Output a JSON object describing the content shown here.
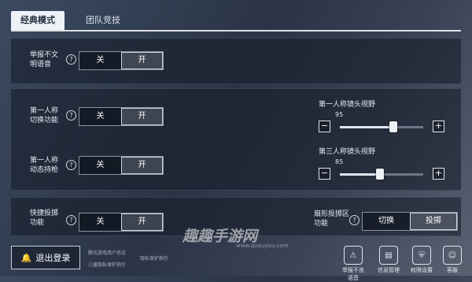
{
  "tabs": [
    {
      "label": "经典模式",
      "active": true
    },
    {
      "label": "团队竞技",
      "active": false
    }
  ],
  "rows": {
    "voice": {
      "label": "举报不文明语音",
      "off": "关",
      "on": "开",
      "selected": "开"
    },
    "fpp_switch": {
      "label": "第一人称切换功能",
      "off": "关",
      "on": "开",
      "selected": "开"
    },
    "fpp_hold": {
      "label": "第一人称动态持枪",
      "off": "关",
      "on": "开",
      "selected": "开"
    },
    "quick_throw": {
      "label": "快捷投掷功能",
      "off": "关",
      "on": "开",
      "selected": "开"
    },
    "fan_throw": {
      "label": "扇形投掷区功能",
      "a": "切换",
      "b": "投掷",
      "selected": "投掷"
    }
  },
  "sliders": {
    "fpp_fov": {
      "label": "第一人称镜头视野",
      "value": "95",
      "fraction": 0.64,
      "minus": "−",
      "plus": "+"
    },
    "tpp_fov": {
      "label": "第三人称镜头视野",
      "value": "85",
      "fraction": 0.48,
      "minus": "−",
      "plus": "+"
    }
  },
  "help_glyph": "?",
  "footer": {
    "logout": "退出登录",
    "links": [
      "腾讯游戏用户协议",
      "儿童隐私保护指引",
      "隐私保护指引"
    ],
    "icons": [
      {
        "name": "report-voice-icon",
        "glyph": "⚠",
        "label": "举报不良语音"
      },
      {
        "name": "info-manage-icon",
        "glyph": "▤",
        "label": "信息管理"
      },
      {
        "name": "permission-icon",
        "glyph": "⛨",
        "label": "权限设置"
      },
      {
        "name": "support-icon",
        "glyph": "☺",
        "label": "客服"
      }
    ]
  },
  "watermark": {
    "text": "趣趣手游网",
    "sub": "www.ququyou.com"
  }
}
